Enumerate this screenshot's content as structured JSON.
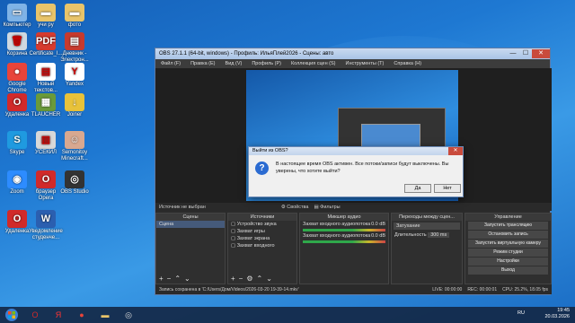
{
  "desktop": {
    "icons": [
      {
        "label": "Компьютер",
        "glyph": "▭",
        "color": "#7fb3e6"
      },
      {
        "label": "учи ру",
        "glyph": "▬",
        "color": "#e8c46a"
      },
      {
        "label": "фото",
        "glyph": "▬",
        "color": "#e8c46a"
      },
      {
        "label": "Корзина",
        "glyph": "🗑",
        "color": "#cfd8e0"
      },
      {
        "label": "Certificate_I...",
        "glyph": "PDF",
        "color": "#d63b2f"
      },
      {
        "label": "Дневник - Электрон...",
        "glyph": "▤",
        "color": "#c73a2e"
      },
      {
        "label": "Google Chrome",
        "glyph": "●",
        "color": "#e8443a"
      },
      {
        "label": "Новый текстов...",
        "glyph": "▤",
        "color": "#ffffff"
      },
      {
        "label": "Yandex",
        "glyph": "Y",
        "color": "#ffffff"
      },
      {
        "label": "Удаленка",
        "glyph": "O",
        "color": "#d12a2a"
      },
      {
        "label": "TLAUCHER",
        "glyph": "▦",
        "color": "#6a9a3a"
      },
      {
        "label": "Joiner",
        "glyph": "↓",
        "color": "#e8c23a"
      },
      {
        "label": "Skype",
        "glyph": "S",
        "color": "#1f9ae0"
      },
      {
        "label": "УСЕКИЛ",
        "glyph": "▥",
        "color": "#d8d8d8"
      },
      {
        "label": "Semonitoy Minecraft...",
        "glyph": "☺",
        "color": "#d8a890"
      },
      {
        "label": "Zoom",
        "glyph": "◉",
        "color": "#2d8cff"
      },
      {
        "label": "браузер Opera",
        "glyph": "O",
        "color": "#d12a2a"
      },
      {
        "label": "OBS Studio",
        "glyph": "◎",
        "color": "#333333"
      },
      {
        "label": "Удаленка",
        "glyph": "O",
        "color": "#d12a2a"
      },
      {
        "label": "Уведомление студенче...",
        "glyph": "W",
        "color": "#2b5fb0"
      }
    ]
  },
  "obs": {
    "title": "OBS 27.1.1 (64-bit, windows) - Профиль: ИльяПлей2026 - Сцены: авто",
    "minimize": "—",
    "maximize": "☐",
    "close": "✕",
    "menu": [
      "Файл (F)",
      "Правка (E)",
      "Вид (V)",
      "Профиль (P)",
      "Коллекция сцен (S)",
      "Инструменты (T)",
      "Справка (H)"
    ],
    "no_source": "Источник не выбран",
    "props_tab": "Свойства",
    "filters_tab": "Фильтры",
    "docks": {
      "scenes": {
        "title": "Сцены",
        "items": [
          "Сцена"
        ]
      },
      "sources": {
        "title": "Источники",
        "items": [
          "Устройство звука",
          "Захват игры",
          "Захват экрана",
          "Захват входного"
        ]
      },
      "mixer": {
        "title": "Микшер аудио",
        "items": [
          {
            "name": "Захват входного аудиопотока",
            "level": "0.0 dB"
          },
          {
            "name": "Захват входного аудиопотока",
            "level": "0.0 dB"
          }
        ]
      },
      "transitions": {
        "title": "Переходы между сцен...",
        "type": "Затухание",
        "duration_label": "Длительность",
        "duration": "300 ms"
      },
      "controls": {
        "title": "Управление",
        "buttons": [
          "Запустить трансляцию",
          "Остановить запись",
          "Запустить виртуальную камеру",
          "Режим студии",
          "Настройки",
          "Выход"
        ]
      }
    },
    "status": {
      "saved": "Запись сохранена в 'C:/Users/Дом/Videos/2026-03-20 19-39-14.mkv'",
      "live": "LIVE: 00:00:00",
      "rec": "REC: 00:00:01",
      "cpu": "CPU: 25.2%, 18.05 fps"
    }
  },
  "dialog": {
    "title": "Выйти из OBS?",
    "message": "В настоящее время OBS активен. Все потоки/записи будут выключены. Вы уверены, что хотите выйти?",
    "yes": "Да",
    "no": "Нет",
    "icon": "?"
  },
  "taskbar": {
    "lang": "RU",
    "time": "19:45",
    "date": "20.03.2026",
    "apps": [
      {
        "glyph": "O",
        "color": "#d12a2a"
      },
      {
        "glyph": "Я",
        "color": "#ff3333"
      },
      {
        "glyph": "●",
        "color": "#e8443a"
      },
      {
        "glyph": "▬",
        "color": "#e8c46a"
      },
      {
        "glyph": "◎",
        "color": "#dddddd"
      }
    ]
  }
}
